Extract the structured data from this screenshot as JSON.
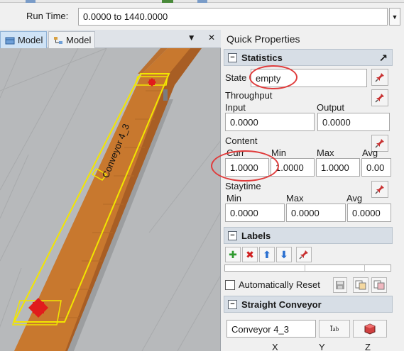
{
  "runtime": {
    "label": "Run Time:",
    "value": "0.0000  to  1440.0000"
  },
  "tabs": [
    {
      "label": "Model"
    },
    {
      "label": "Model"
    }
  ],
  "viewport": {
    "conveyor_label": "Conveyor 4_3"
  },
  "panel": {
    "title": "Quick Properties",
    "statistics": {
      "header": "Statistics",
      "state_label": "State",
      "state_value": "empty",
      "throughput_label": "Throughput",
      "input_label": "Input",
      "input_value": "0.0000",
      "output_label": "Output",
      "output_value": "0.0000",
      "content_label": "Content",
      "content_cols": [
        "Curr",
        "Min",
        "Max",
        "Avg"
      ],
      "content_values": [
        "1.0000",
        "1.0000",
        "1.0000",
        "0.00"
      ],
      "staytime_label": "Staytime",
      "staytime_cols": [
        "Min",
        "Max",
        "Avg"
      ],
      "staytime_values": [
        "0.0000",
        "0.0000",
        "0.0000"
      ]
    },
    "labels": {
      "header": "Labels",
      "auto_reset_label": "Automatically Reset"
    },
    "straight_conveyor": {
      "header": "Straight Conveyor",
      "name_value": "Conveyor 4_3",
      "axes": [
        "X",
        "Y",
        "Z"
      ]
    }
  },
  "colors": {
    "conveyor": "#c8782e",
    "selection": "#f2e600",
    "highlight": "#e03c3c",
    "section_header": "#d7dee6"
  }
}
